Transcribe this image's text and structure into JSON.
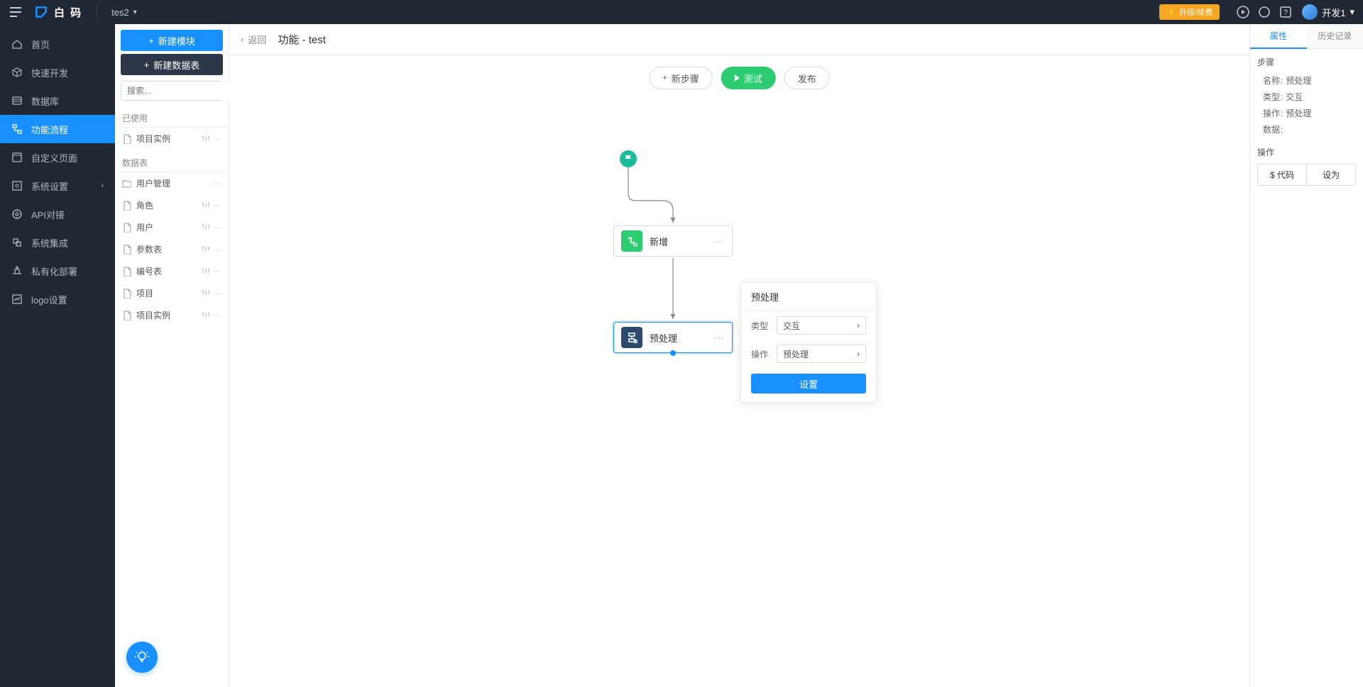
{
  "topbar": {
    "brand": "白 码",
    "app_name": "tes2",
    "upgrade_label": "升级/续费",
    "user_name": "开发1"
  },
  "nav": {
    "items": [
      {
        "label": "首页",
        "icon": "home"
      },
      {
        "label": "快速开发",
        "icon": "box"
      },
      {
        "label": "数据库",
        "icon": "db"
      },
      {
        "label": "功能流程",
        "icon": "flow",
        "active": true
      },
      {
        "label": "自定义页面",
        "icon": "page"
      },
      {
        "label": "系统设置",
        "icon": "settings",
        "chev": true
      },
      {
        "label": "API对接",
        "icon": "api"
      },
      {
        "label": "系统集成",
        "icon": "integrate"
      },
      {
        "label": "私有化部署",
        "icon": "deploy"
      },
      {
        "label": "logo设置",
        "icon": "logo"
      }
    ]
  },
  "sidebar2": {
    "new_module_label": "新建模块",
    "new_table_label": "新建数据表",
    "search_placeholder": "搜索...",
    "sections": {
      "used": {
        "title": "已使用",
        "items": [
          {
            "label": "项目实例",
            "icon": "file",
            "actions": true
          }
        ]
      },
      "tables": {
        "title": "数据表",
        "items": [
          {
            "label": "用户管理",
            "icon": "folder",
            "group": true
          },
          {
            "label": "角色",
            "icon": "file",
            "actions": true
          },
          {
            "label": "用户",
            "icon": "file",
            "actions": true
          },
          {
            "label": "参数表",
            "icon": "file",
            "actions": true
          },
          {
            "label": "编号表",
            "icon": "file",
            "actions": true
          },
          {
            "label": "项目",
            "icon": "file",
            "actions": true
          },
          {
            "label": "项目实例",
            "icon": "file",
            "actions": true
          }
        ]
      }
    }
  },
  "content": {
    "back_label": "返回",
    "title": "功能 - test",
    "toolbar": {
      "new_step": "新步骤",
      "test": "测试",
      "publish": "发布"
    },
    "nodes": {
      "add": "新增",
      "preprocess": "预处理"
    }
  },
  "popover": {
    "title": "预处理",
    "type_label": "类型",
    "type_value": "交互",
    "action_label": "操作",
    "action_value": "预处理",
    "btn": "设置"
  },
  "right_panel": {
    "tabs": {
      "attr": "属性",
      "history": "历史记录"
    },
    "sec_step": "步骤",
    "kv": {
      "name_k": "名称",
      "name_v": "预处理",
      "type_k": "类型",
      "type_v": "交互",
      "action_k": "操作",
      "action_v": "预处理",
      "data_k": "数据",
      "data_v": ""
    },
    "sec_op": "操作",
    "btn_code": "$ 代码",
    "btn_setas": "设为"
  }
}
